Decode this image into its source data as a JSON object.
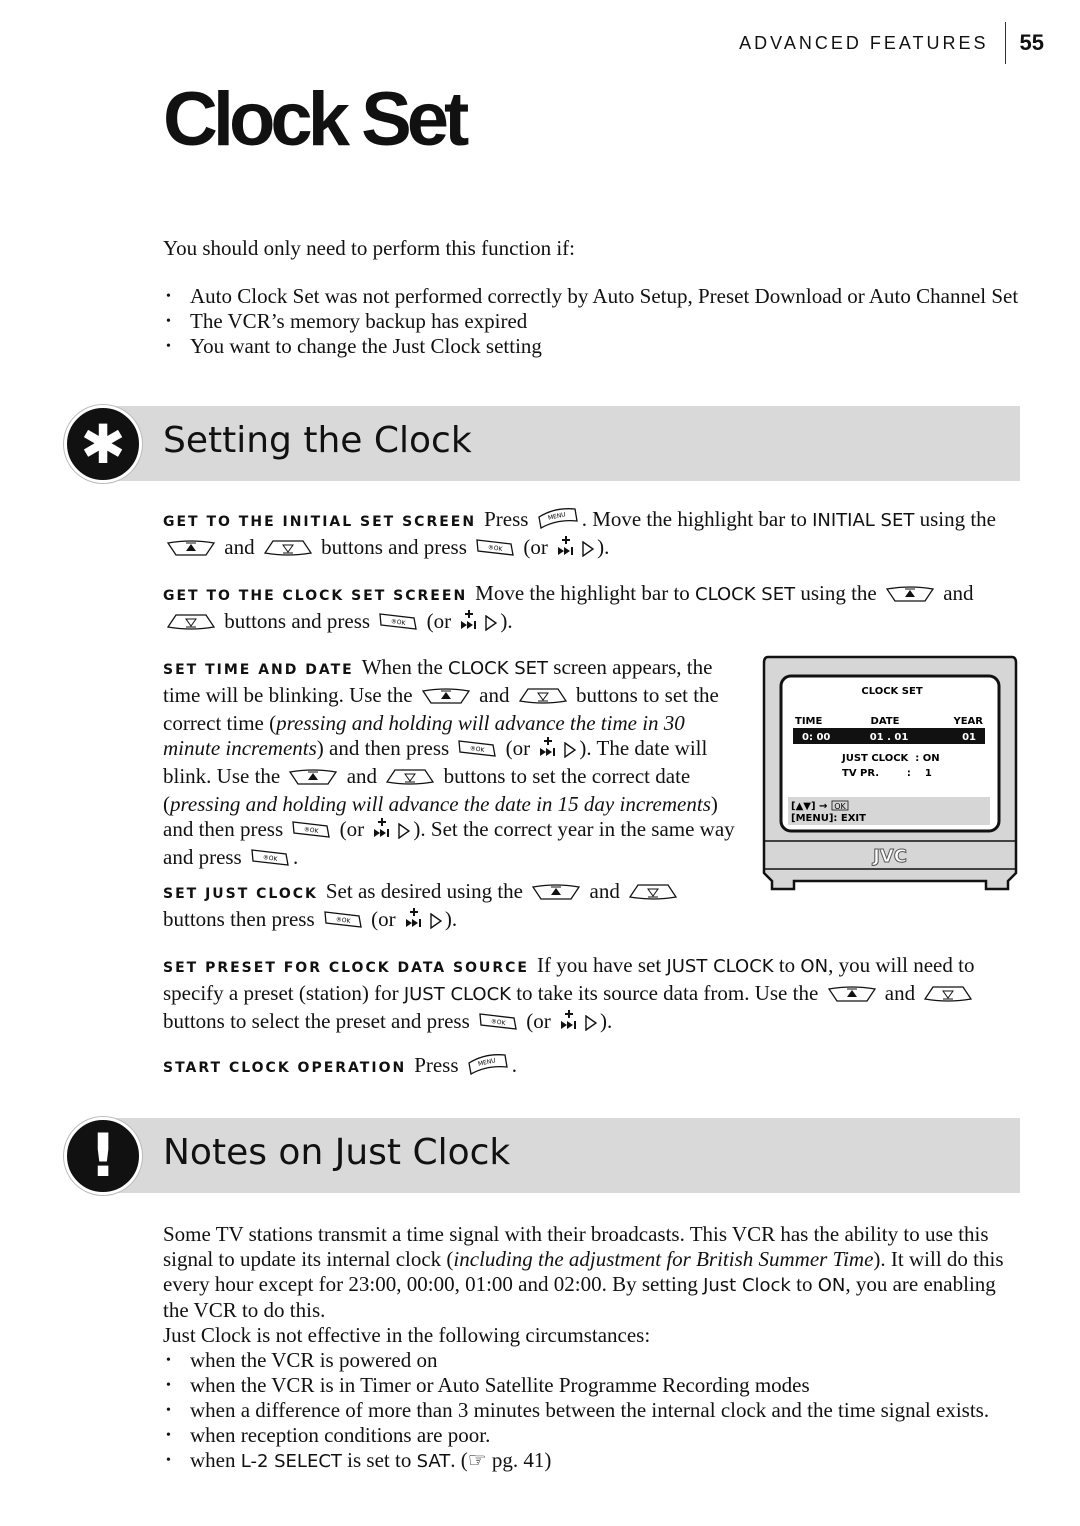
{
  "header": {
    "section": "ADVANCED FEATURES",
    "page": "55"
  },
  "title": "Clock Set",
  "intro": "You should only need to perform this function if:",
  "intro_bullets": [
    "Auto Clock Set was not performed correctly by Auto Setup, Preset Download or Auto Channel Set",
    "The VCR’s memory backup has expired",
    "You want to change the Just Clock setting"
  ],
  "setting": {
    "heading": "Setting the Clock",
    "icon": "asterisk-icon",
    "steps": [
      {
        "label": "GET TO THE INITIAL SET SCREEN",
        "body": [
          "Press ",
          {
            "icon": "menu"
          },
          ". Move the highlight bar to ",
          {
            "b": "INITIAL SET"
          },
          " using the ",
          {
            "icon": "up"
          },
          " and ",
          {
            "icon": "down"
          },
          " buttons and press ",
          {
            "icon": "ok"
          },
          " (or ",
          {
            "icon": "ff"
          },
          {
            "icon": "play"
          },
          ")."
        ]
      },
      {
        "label": "GET TO THE CLOCK SET SCREEN",
        "body": [
          "Move the highlight bar to ",
          {
            "b": "CLOCK SET"
          },
          " using the ",
          {
            "icon": "up"
          },
          " and ",
          {
            "icon": "down"
          },
          " buttons and press ",
          {
            "icon": "ok"
          },
          " (or ",
          {
            "icon": "ff"
          },
          {
            "icon": "play"
          },
          ")."
        ]
      },
      {
        "label": "SET TIME AND DATE",
        "body": [
          "When the ",
          {
            "b": "CLOCK SET"
          },
          " screen appears, the time will be blinking. Use the ",
          {
            "icon": "up"
          },
          " and ",
          {
            "icon": "down"
          },
          " buttons to set the correct time (",
          {
            "i": "pressing and holding will advance the time in 30 minute increments"
          },
          ") and then press ",
          {
            "icon": "ok"
          },
          " (or ",
          {
            "icon": "ff"
          },
          {
            "icon": "play"
          },
          "). The date will blink. Use the ",
          {
            "icon": "up"
          },
          " and ",
          {
            "icon": "down"
          },
          " buttons to set the correct date (",
          {
            "i": "pressing and holding will advance the date in 15 day incre­ments"
          },
          ") and then press ",
          {
            "icon": "ok"
          },
          " (or ",
          {
            "icon": "ff"
          },
          {
            "icon": "play"
          },
          "). Set the correct year in the same way and press ",
          {
            "icon": "ok"
          },
          "."
        ]
      },
      {
        "label": "SET JUST CLOCK",
        "body": [
          "Set as desired using the ",
          {
            "icon": "up"
          },
          " and ",
          {
            "icon": "down"
          },
          " buttons then press ",
          {
            "icon": "ok"
          },
          " (or ",
          {
            "icon": "ff"
          },
          {
            "icon": "play"
          },
          ")."
        ]
      },
      {
        "label": "SET PRESET FOR CLOCK DATA SOURCE",
        "body": [
          "If you have set ",
          {
            "b": "JUST CLOCK"
          },
          " to ",
          {
            "b": "ON"
          },
          ", you will need to specify a preset (station) for ",
          {
            "b": "JUST CLOCK"
          },
          " to take its source data from. Use the ",
          {
            "icon": "up"
          },
          " and ",
          {
            "icon": "down"
          },
          " buttons to select the preset and press ",
          {
            "icon": "ok"
          },
          " (or ",
          {
            "icon": "ff"
          },
          {
            "icon": "play"
          },
          ")."
        ]
      },
      {
        "label": "START CLOCK OPERATION",
        "body": [
          "Press ",
          {
            "icon": "menu"
          },
          "."
        ]
      }
    ]
  },
  "tv_screen": {
    "title": "CLOCK SET",
    "col_time": "TIME",
    "col_date": "DATE",
    "col_year": "YEAR",
    "time": "0: 00",
    "date": "01 . 01",
    "year": "01",
    "just_clock": "JUST CLOCK  : ON",
    "tv_pr": "TV PR.        :    1",
    "hint1": "[▲▼] →",
    "hint_ok": "OK",
    "hint2": "[MENU]: EXIT",
    "brand": "JVC"
  },
  "notes": {
    "heading": "Notes on Just Clock",
    "icon": "exclamation-icon",
    "para1": [
      "Some TV stations transmit a time signal with their broadcasts. This VCR has the ability to use this signal to update its internal clock (",
      {
        "i": "including the adjustment for British Summer Time"
      },
      "). It will do this every hour except for 23:00, 00:00, 01:00 and 02:00. By setting ",
      {
        "b": "Just Clock"
      },
      " to ",
      {
        "b": "ON"
      },
      ", you are enabling the VCR to do this."
    ],
    "para2": "Just Clock is not effective in the following circumstances:",
    "bullets": [
      [
        "when the VCR is powered on"
      ],
      [
        "when the VCR is in Timer or Auto Satellite Programme Recording modes"
      ],
      [
        "when a difference of more than 3 minutes between the internal clock and the time signal exists."
      ],
      [
        "when reception conditions are poor."
      ],
      [
        "when ",
        {
          "b": "L-2 SELECT"
        },
        " is set to ",
        {
          "b": "SAT"
        },
        ". (☞ pg. 41)"
      ]
    ]
  }
}
